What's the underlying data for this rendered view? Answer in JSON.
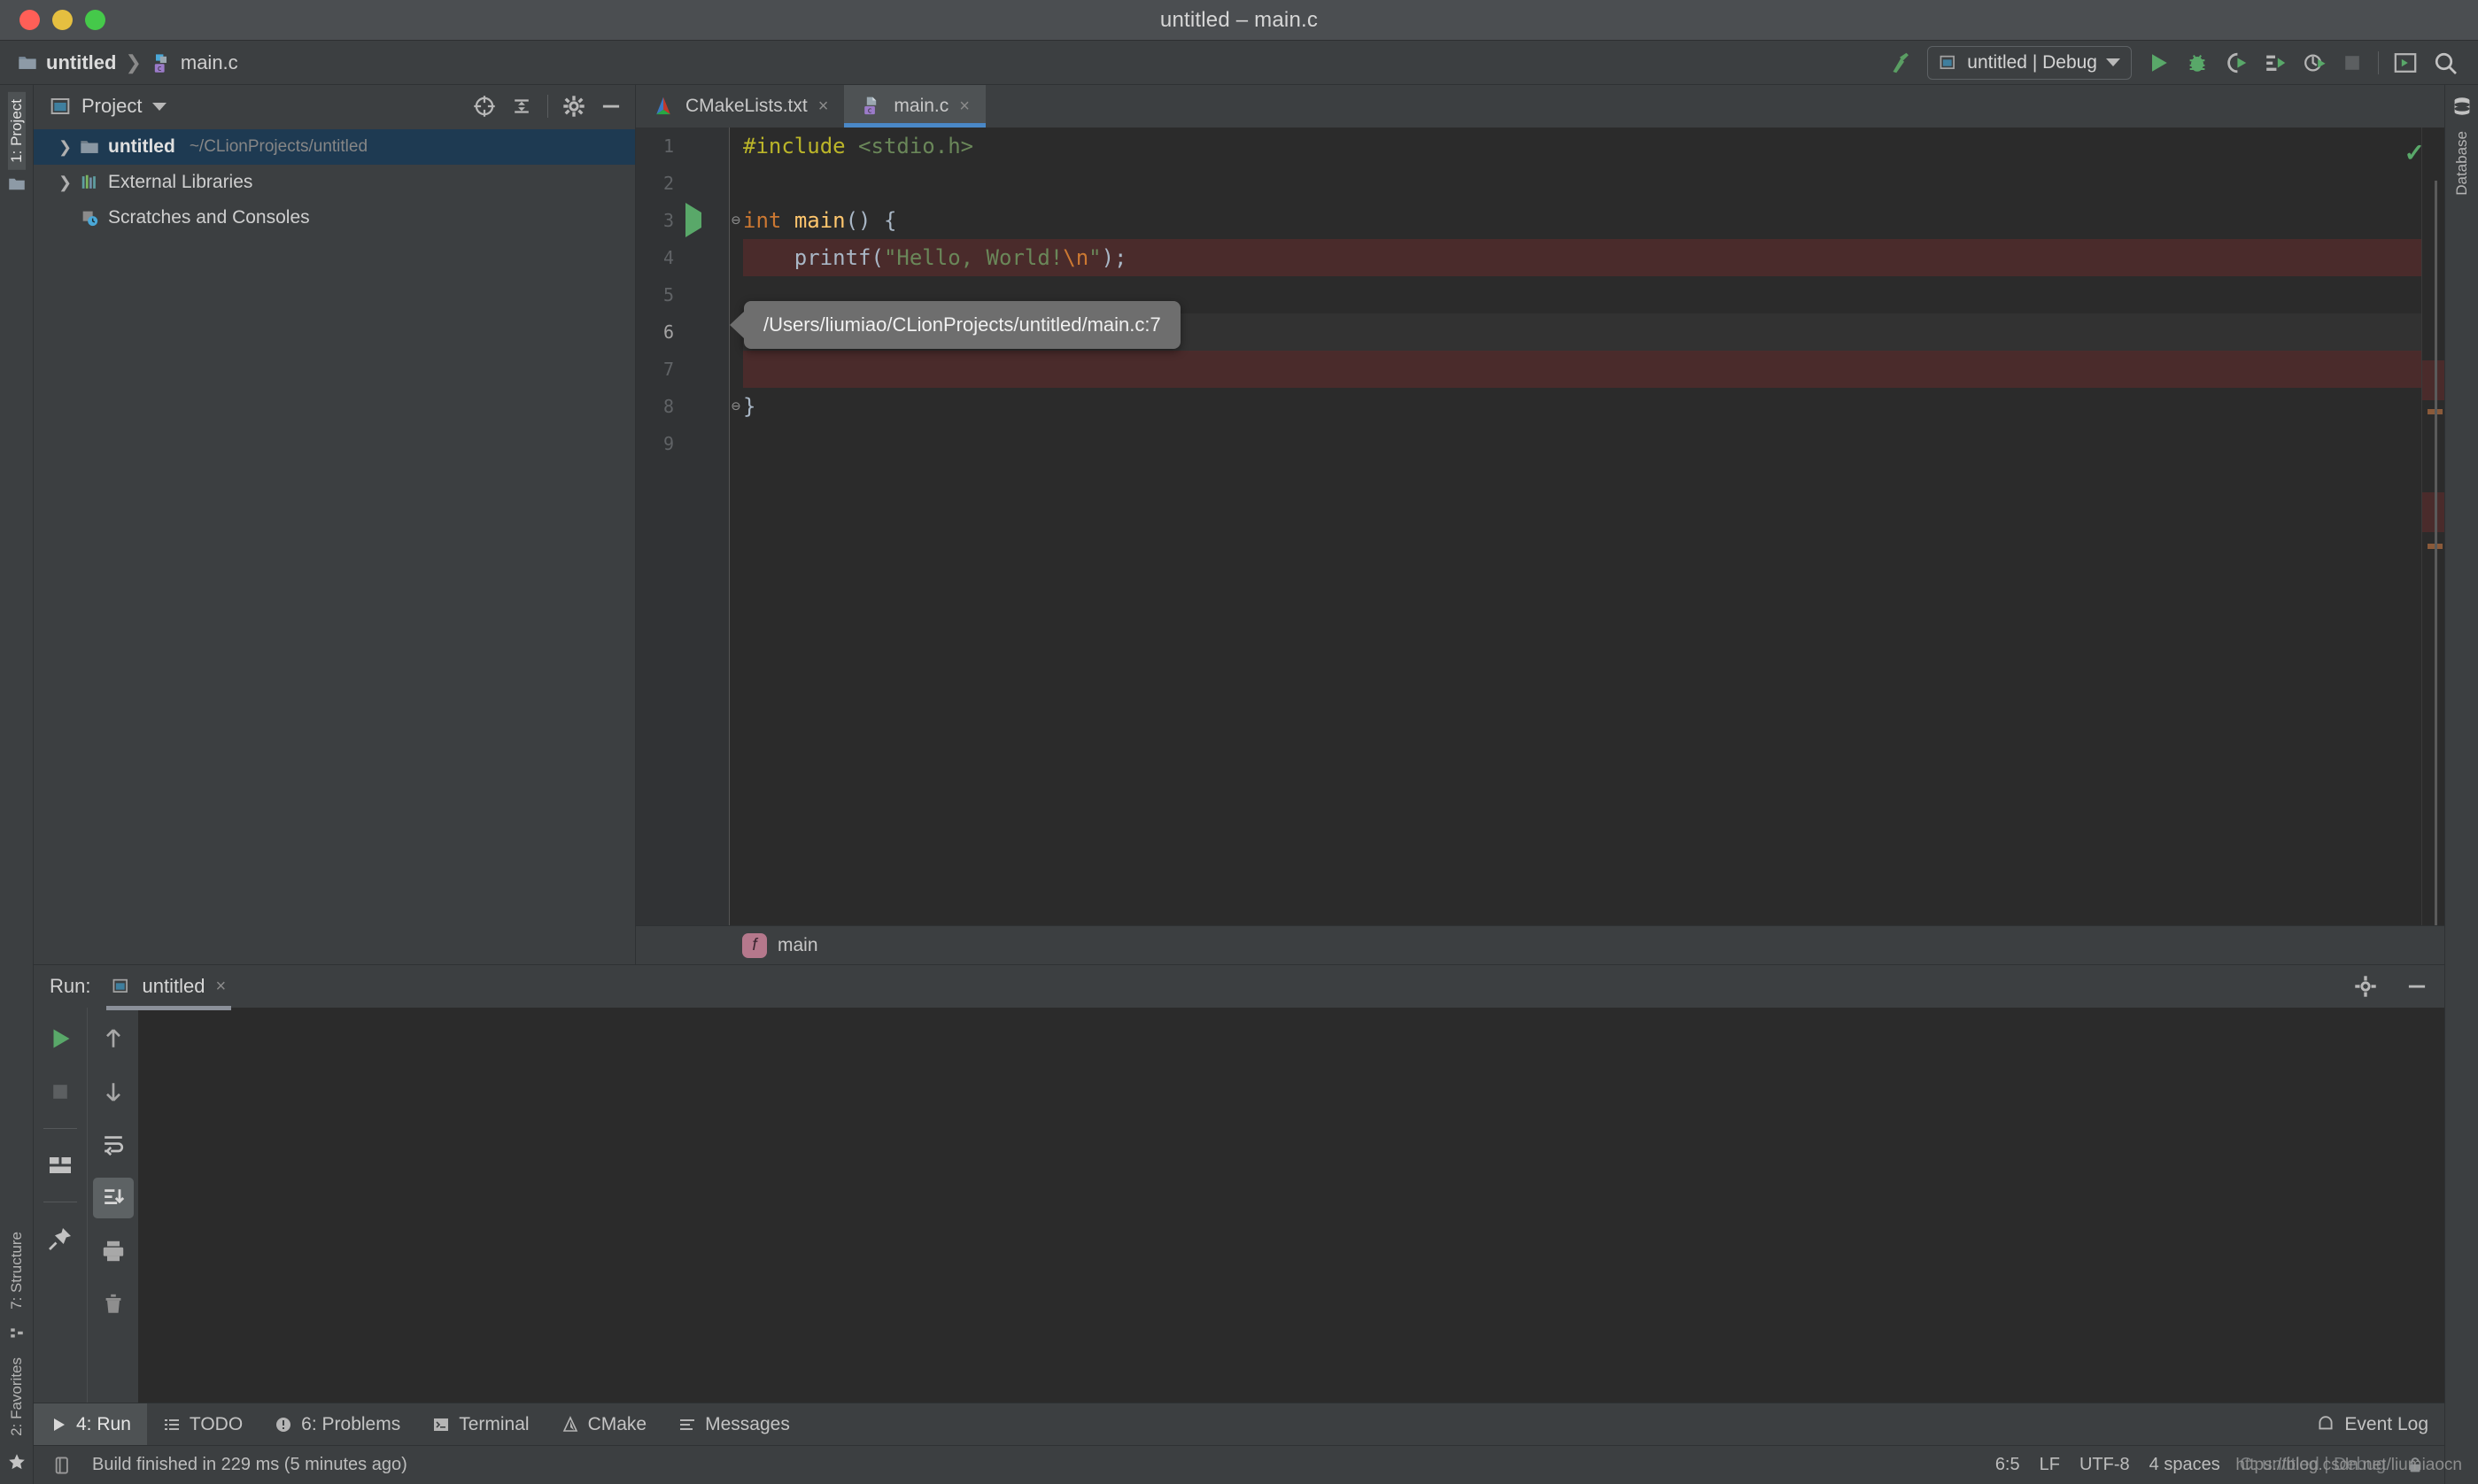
{
  "window": {
    "title": "untitled – main.c",
    "traffic_lights": [
      "close",
      "minimize",
      "zoom"
    ]
  },
  "navbar": {
    "breadcrumb": [
      {
        "label": "untitled",
        "icon": "folder-icon"
      },
      {
        "label": "main.c",
        "icon": "c-file-icon"
      }
    ],
    "separator": "❯",
    "hammer_icon": "build-hammer-icon",
    "run_config": {
      "label": "untitled | Debug",
      "icon": "run-config-icon",
      "chevron": "chevron-down-icon"
    },
    "actions": [
      {
        "name": "run-button",
        "icon": "play-icon"
      },
      {
        "name": "debug-button",
        "icon": "bug-icon"
      },
      {
        "name": "run-with-coverage-button",
        "icon": "coverage-icon"
      },
      {
        "name": "profile-button",
        "icon": "profile-icon"
      },
      {
        "name": "attach-button",
        "icon": "attach-icon"
      },
      {
        "name": "stop-button",
        "icon": "stop-icon"
      },
      {
        "name": "open-in-terminal-button",
        "icon": "terminal-window-icon"
      },
      {
        "name": "search-everywhere-button",
        "icon": "search-icon"
      }
    ]
  },
  "left_strip": [
    {
      "label": "1: Project",
      "selected": true,
      "icon": "folder-icon"
    },
    {
      "label": "7: Structure",
      "selected": false,
      "icon": "structure-icon"
    },
    {
      "label": "2: Favorites",
      "selected": false,
      "icon": "star-icon"
    }
  ],
  "right_strip": [
    {
      "label": "Database",
      "icon": "database-icon"
    }
  ],
  "project_tool_window": {
    "title": "Project",
    "chevron": "chevron-down-icon",
    "toolbar": [
      {
        "name": "scroll-from-source-button",
        "icon": "target-icon"
      },
      {
        "name": "collapse-all-button",
        "icon": "collapse-all-icon"
      },
      {
        "name": "settings-button",
        "icon": "gear-icon"
      },
      {
        "name": "hide-button",
        "icon": "minus-icon"
      }
    ],
    "tree": [
      {
        "name": "untitled",
        "path": "~/CLionProjects/untitled",
        "expandable": true,
        "selected": true,
        "icon": "folder-icon"
      },
      {
        "name": "External Libraries",
        "path": "",
        "expandable": true,
        "selected": false,
        "icon": "libraries-icon"
      },
      {
        "name": "Scratches and Consoles",
        "path": "",
        "expandable": false,
        "selected": false,
        "icon": "scratches-icon"
      }
    ]
  },
  "editor": {
    "tabs": [
      {
        "label": "CMakeLists.txt",
        "active": false,
        "icon": "cmake-icon",
        "close": "×"
      },
      {
        "label": "main.c",
        "active": true,
        "icon": "c-file-icon",
        "close": "×"
      }
    ],
    "lines": [
      {
        "num": "1",
        "marker": "",
        "fold": "",
        "highlight": "",
        "tokens": [
          {
            "t": "#include ",
            "c": "k-pre"
          },
          {
            "t": "<stdio.h>",
            "c": "k-inc"
          }
        ]
      },
      {
        "num": "2",
        "marker": "",
        "fold": "",
        "highlight": "",
        "tokens": []
      },
      {
        "num": "3",
        "marker": "run-arrow",
        "fold": "⊖",
        "highlight": "",
        "tokens": [
          {
            "t": "int",
            "c": "k-type"
          },
          {
            "t": " ",
            "c": "k-plain"
          },
          {
            "t": "main",
            "c": "k-fn"
          },
          {
            "t": "() {",
            "c": "k-plain"
          }
        ]
      },
      {
        "num": "4",
        "marker": "breakpoint",
        "fold": "",
        "highlight": "error",
        "tokens": [
          {
            "t": "    printf(",
            "c": "k-plain"
          },
          {
            "t": "\"Hello, World!",
            "c": "k-str"
          },
          {
            "t": "\\n",
            "c": "k-esc"
          },
          {
            "t": "\"",
            "c": "k-str"
          },
          {
            "t": ");",
            "c": "k-plain"
          }
        ]
      },
      {
        "num": "5",
        "marker": "",
        "fold": "",
        "highlight": "",
        "tokens": []
      },
      {
        "num": "6",
        "marker": "",
        "fold": "",
        "highlight": "current",
        "tokens": []
      },
      {
        "num": "7",
        "marker": "breakpoint",
        "fold": "",
        "highlight": "error",
        "tokens": []
      },
      {
        "num": "8",
        "marker": "",
        "fold": "⊖",
        "highlight": "",
        "tokens": [
          {
            "t": "}",
            "c": "k-plain"
          }
        ]
      },
      {
        "num": "9",
        "marker": "",
        "fold": "",
        "highlight": "",
        "tokens": []
      }
    ],
    "inspection_status": "ok-check-icon",
    "tooltip": {
      "text": "/Users/liumiao/CLionProjects/untitled/main.c:7"
    },
    "breadcrumb": {
      "badge": "f",
      "label": "main"
    }
  },
  "run_tool_window": {
    "label": "Run:",
    "tab": {
      "label": "untitled",
      "icon": "run-config-icon",
      "close": "×"
    },
    "toolbar_left": [
      {
        "name": "rerun-button",
        "icon": "play-icon"
      },
      {
        "name": "stop-button",
        "icon": "stop-icon"
      },
      {
        "name": "layout-button",
        "icon": "layout-icon"
      },
      {
        "name": "pin-tab-button",
        "icon": "pin-icon"
      }
    ],
    "toolbar_right": [
      {
        "name": "up-button",
        "icon": "arrow-up-icon"
      },
      {
        "name": "down-button",
        "icon": "arrow-down-icon"
      },
      {
        "name": "soft-wrap-button",
        "icon": "soft-wrap-icon"
      },
      {
        "name": "scroll-to-end-button",
        "icon": "scroll-end-icon",
        "active": true
      },
      {
        "name": "print-button",
        "icon": "printer-icon"
      },
      {
        "name": "clear-all-button",
        "icon": "trash-icon"
      }
    ],
    "header_actions": [
      {
        "name": "settings-button",
        "icon": "gear-icon"
      },
      {
        "name": "hide-button",
        "icon": "minus-icon"
      }
    ],
    "console_output": ""
  },
  "bottom_bar": {
    "items": [
      {
        "label": "4: Run",
        "underline": "4",
        "icon": "play-icon",
        "selected": true
      },
      {
        "label": "TODO",
        "underline": "",
        "icon": "todo-icon",
        "selected": false
      },
      {
        "label": "6: Problems",
        "underline": "6",
        "icon": "problems-icon",
        "selected": false
      },
      {
        "label": "Terminal",
        "underline": "",
        "icon": "terminal-icon",
        "selected": false
      },
      {
        "label": "CMake",
        "underline": "",
        "icon": "cmake-icon",
        "selected": false
      },
      {
        "label": "Messages",
        "underline": "",
        "icon": "messages-icon",
        "selected": false
      }
    ],
    "event_log": {
      "label": "Event Log",
      "icon": "event-log-icon"
    }
  },
  "status_bar": {
    "build_message": "Build finished in 229 ms (5 minutes ago)",
    "build_icon": "build-status-icon",
    "caret_position": "6:5",
    "line_separator": "LF",
    "encoding": "UTF-8",
    "indent": "4 spaces",
    "run_config": "C: untitled | Debug",
    "lock_icon": "unlocked-icon"
  },
  "watermark": "https://blog.csdn.net/liumiaocn",
  "colors": {
    "chrome": "#3c3f41",
    "editor_bg": "#2b2b2b",
    "gutter_bg": "#313335",
    "tab_active": "#4e5254",
    "tab_underline": "#4a88c7",
    "tree_selection": "#1e3a52",
    "error_line": "#4a2b2b",
    "breakpoint": "#db5860",
    "run_green": "#59a869",
    "tooltip_bg": "#6e6e6e"
  }
}
